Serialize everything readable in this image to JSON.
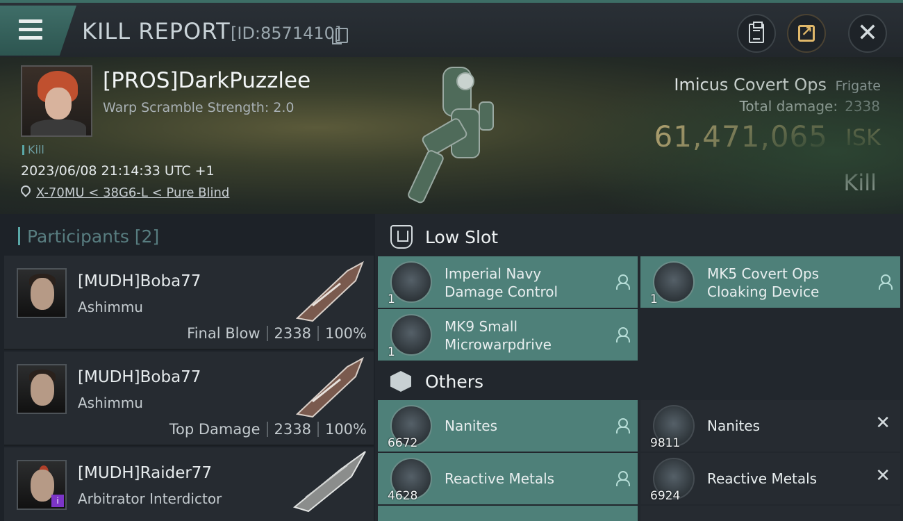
{
  "header": {
    "title": "KILL REPORT",
    "id_text": "[ID:8571410]"
  },
  "victim": {
    "name": "[PROS]DarkPuzzlee",
    "warp_scramble": "Warp Scramble Strength: 2.0",
    "kill_tag": "Kill",
    "datetime": "2023/06/08 21:14:33 UTC +1",
    "location": "X-70MU < 38G6-L < Pure Blind"
  },
  "ship": {
    "name": "Imicus Covert Ops",
    "class": "Frigate",
    "total_damage_label": "Total damage:",
    "total_damage_value": "2338",
    "isk_value": "61,471,065",
    "isk_unit": "ISK",
    "result": "Kill"
  },
  "participants": {
    "header": "Participants [2]",
    "rows": [
      {
        "name": "[MUDH]Boba77",
        "ship": "Ashimmu",
        "role": "Final Blow",
        "damage": "2338",
        "percent": "100%"
      },
      {
        "name": "[MUDH]Boba77",
        "ship": "Ashimmu",
        "role": "Top Damage",
        "damage": "2338",
        "percent": "100%"
      },
      {
        "name": "[MUDH]Raider77",
        "ship": "Arbitrator Interdictor",
        "role": "",
        "damage": "",
        "percent": ""
      }
    ]
  },
  "low_slot": {
    "label": "Low Slot",
    "items": [
      {
        "name_line1": "Imperial Navy",
        "name_line2": "Damage Control",
        "qty": "1"
      },
      {
        "name_line1": "MK5 Covert Ops",
        "name_line2": "Cloaking Device",
        "qty": "1"
      },
      {
        "name_line1": "MK9 Small",
        "name_line2": "Microwarpdrive",
        "qty": "1"
      }
    ]
  },
  "others": {
    "label": "Others",
    "items": [
      {
        "name": "Nanites",
        "qty": "6672",
        "status": "dropped"
      },
      {
        "name": "Nanites",
        "qty": "9811",
        "status": "destroyed"
      },
      {
        "name": "Reactive Metals",
        "qty": "4628",
        "status": "dropped"
      },
      {
        "name": "Reactive Metals",
        "qty": "6924",
        "status": "destroyed"
      }
    ]
  },
  "colors": {
    "accent_teal": "#4e8079",
    "isk_gold": "#e6c789",
    "background": "#1b1f24"
  }
}
